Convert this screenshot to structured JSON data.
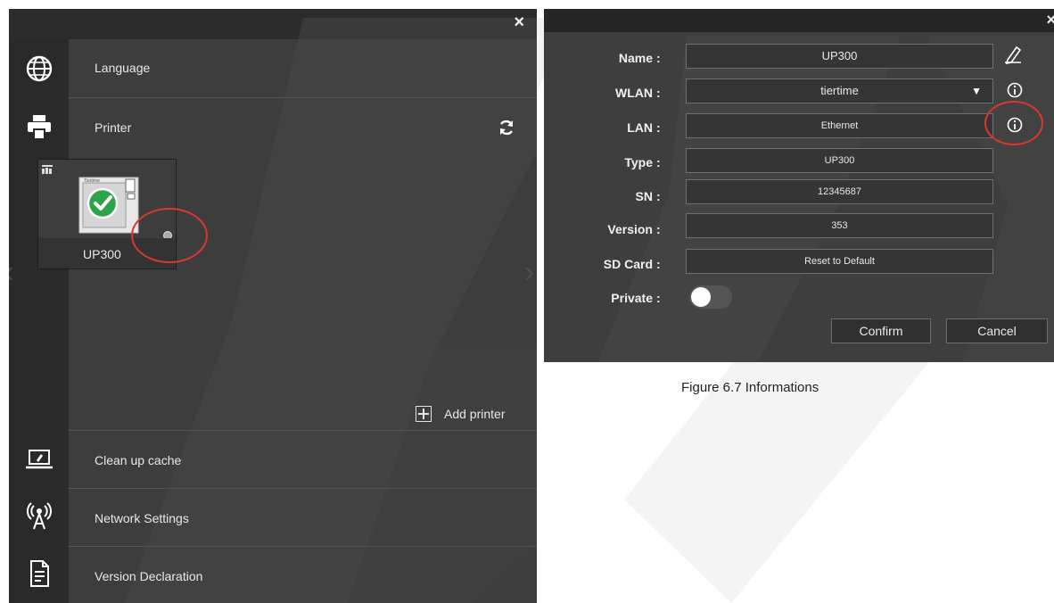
{
  "settings_panel": {
    "close_glyph": "×",
    "items": [
      {
        "label": "Language",
        "icon": "globe-icon"
      },
      {
        "label": "Printer",
        "icon": "printer-icon"
      },
      {
        "label": "Clean up cache",
        "icon": "laptop-icon"
      },
      {
        "label": "Network Settings",
        "icon": "antenna-icon"
      },
      {
        "label": "Version Declaration",
        "icon": "document-icon"
      }
    ],
    "printer_card": {
      "name": "UP300",
      "thumbnail_text": "Tiertime",
      "status_icon": "checkmark-icon"
    },
    "add_printer_label": "Add printer",
    "refresh_icon": "refresh-icon",
    "prev_arrow": "‹",
    "next_arrow": "›"
  },
  "info_dialog": {
    "close_glyph": "×",
    "fields": [
      {
        "label": "Name",
        "value": "UP300",
        "icon": "edit-icon"
      },
      {
        "label": "WLAN",
        "value": "tiertime",
        "dropdown_arrow": "▼",
        "icon": "info-icon"
      },
      {
        "label": "LAN",
        "value": "Ethernet",
        "icon": "info-icon"
      },
      {
        "label": "Type",
        "value": "UP300"
      },
      {
        "label": "SN",
        "value": "12345687"
      },
      {
        "label": "Version",
        "value": "353"
      },
      {
        "label": "SD Card",
        "value": "Reset to Default"
      },
      {
        "label": "Private"
      }
    ],
    "colon": ":",
    "private_toggle_on": false,
    "confirm_label": "Confirm",
    "cancel_label": "Cancel"
  },
  "caption": "Figure 6.7 Informations",
  "colors": {
    "panel_bg": "#3d3d3d",
    "highlight_circle": "#d9382c",
    "check_green": "#2fa34a"
  }
}
